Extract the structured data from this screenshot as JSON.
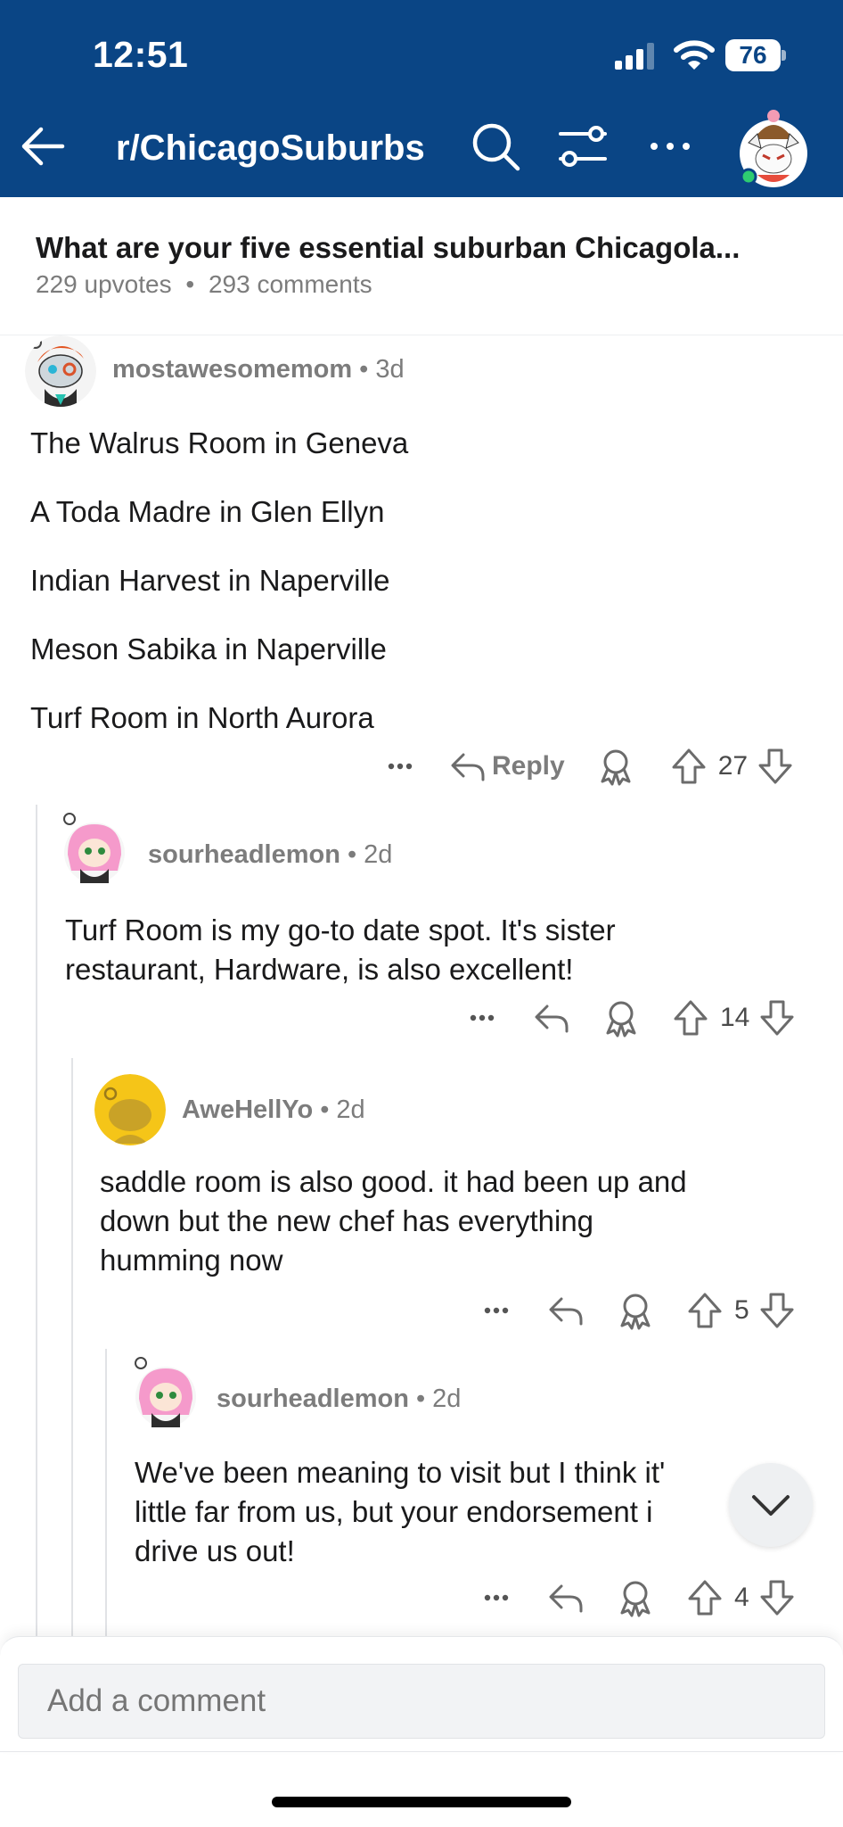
{
  "status_bar": {
    "time": "12:51",
    "battery": "76"
  },
  "nav": {
    "subreddit": "r/ChicagoSuburbs"
  },
  "post": {
    "title": "What are your five essential suburban Chicagola...",
    "upvotes": "229 upvotes",
    "comments": "293 comments",
    "sep": "•"
  },
  "comments": [
    {
      "user": "mostawesomemom",
      "age": "3d",
      "lines": [
        "The Walrus Room in Geneva",
        "A Toda Madre in Glen Ellyn",
        "Indian Harvest in Naperville",
        "Meson Sabika in Naperville",
        "Turf Room in North Aurora"
      ],
      "reply_label": "Reply",
      "votes": "27"
    },
    {
      "user": "sourheadlemon",
      "age": "2d",
      "lines": [
        "Turf Room is my go-to date spot. It's sister",
        "restaurant, Hardware, is also excellent!"
      ],
      "votes": "14"
    },
    {
      "user": "AweHellYo",
      "age": "2d",
      "lines": [
        "saddle room is also good. it had been up and",
        "down but the new chef has everything",
        "humming now"
      ],
      "votes": "5"
    },
    {
      "user": "sourheadlemon",
      "age": "2d",
      "lines": [
        "We've been meaning to visit but I think it'",
        "little far from us, but your endorsement i",
        "drive us out!"
      ],
      "votes": "4"
    }
  ],
  "composer": {
    "placeholder": "Add a comment"
  },
  "icons": {
    "back": "arrow-left-icon",
    "search": "search-icon",
    "filter": "sliders-icon",
    "more": "more-dots-icon",
    "reply": "reply-arrow-icon",
    "award": "award-icon",
    "upvote": "upvote-arrow-icon",
    "downvote": "downvote-arrow-icon",
    "jump": "chevron-down-icon"
  },
  "colors": {
    "header_bg": "#0a4585",
    "text": "#1a1a1b",
    "meta": "#7c7c7c",
    "online": "#2ecc71"
  }
}
